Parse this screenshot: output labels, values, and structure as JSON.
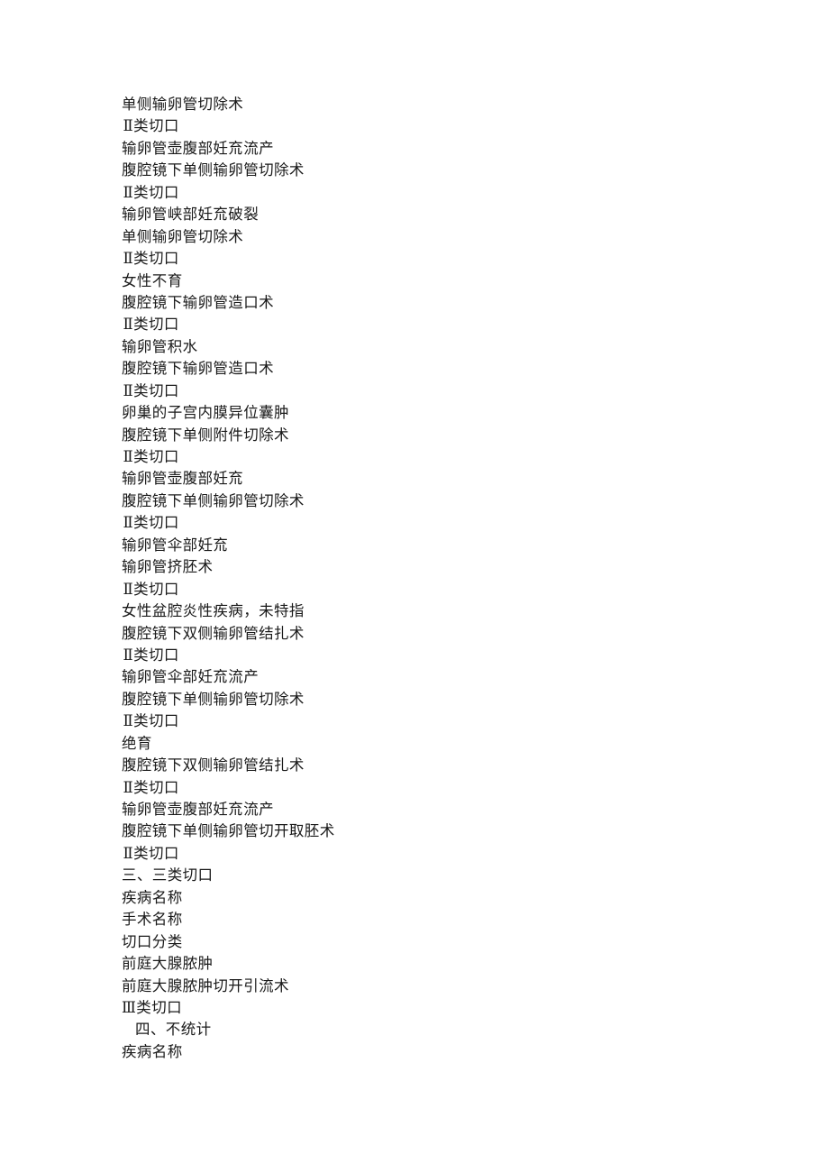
{
  "document": {
    "page_background": "#ffffff",
    "text_color": "#1a1a1a",
    "missing_glyph": "㐬",
    "lines": [
      {
        "text": "单侧输卵管切除术",
        "indent": "none"
      },
      {
        "text": "Ⅱ类切口",
        "indent": "roman"
      },
      {
        "text": "输卵管壶腹部妊㐬流产",
        "indent": "none"
      },
      {
        "text": "腹腔镜下单侧输卵管切除术",
        "indent": "none"
      },
      {
        "text": "Ⅱ类切口",
        "indent": "roman"
      },
      {
        "text": "输卵管峡部妊㐬破裂",
        "indent": "none"
      },
      {
        "text": "单侧输卵管切除术",
        "indent": "none"
      },
      {
        "text": "Ⅱ类切口",
        "indent": "roman"
      },
      {
        "text": "女性不育",
        "indent": "none"
      },
      {
        "text": "腹腔镜下输卵管造口术",
        "indent": "none"
      },
      {
        "text": "Ⅱ类切口",
        "indent": "roman"
      },
      {
        "text": "输卵管积水",
        "indent": "none"
      },
      {
        "text": "腹腔镜下输卵管造口术",
        "indent": "none"
      },
      {
        "text": "Ⅱ类切口",
        "indent": "roman"
      },
      {
        "text": "卵巢的子宫内膜异位囊肿",
        "indent": "none"
      },
      {
        "text": "腹腔镜下单侧附件切除术",
        "indent": "none"
      },
      {
        "text": "Ⅱ类切口",
        "indent": "roman"
      },
      {
        "text": "输卵管壶腹部妊㐬",
        "indent": "none"
      },
      {
        "text": "腹腔镜下单侧输卵管切除术",
        "indent": "none"
      },
      {
        "text": "Ⅱ类切口",
        "indent": "roman"
      },
      {
        "text": "输卵管伞部妊㐬",
        "indent": "none"
      },
      {
        "text": "输卵管挤胚术",
        "indent": "none"
      },
      {
        "text": "Ⅱ类切口",
        "indent": "roman"
      },
      {
        "text": "女性盆腔炎性疾病，未特指",
        "indent": "none"
      },
      {
        "text": "腹腔镜下双侧输卵管结扎术",
        "indent": "none"
      },
      {
        "text": "Ⅱ类切口",
        "indent": "roman"
      },
      {
        "text": "输卵管伞部妊㐬流产",
        "indent": "none"
      },
      {
        "text": "腹腔镜下单侧输卵管切除术",
        "indent": "none"
      },
      {
        "text": "Ⅱ类切口",
        "indent": "roman"
      },
      {
        "text": "绝育",
        "indent": "none"
      },
      {
        "text": "腹腔镜下双侧输卵管结扎术",
        "indent": "none"
      },
      {
        "text": "Ⅱ类切口",
        "indent": "roman"
      },
      {
        "text": "输卵管壶腹部妊㐬流产",
        "indent": "none"
      },
      {
        "text": "腹腔镜下单侧输卵管切开取胚术",
        "indent": "none"
      },
      {
        "text": "Ⅱ类切口",
        "indent": "roman"
      },
      {
        "text": "三、三类切口",
        "indent": "none"
      },
      {
        "text": "疾病名称",
        "indent": "none"
      },
      {
        "text": "手术名称",
        "indent": "none"
      },
      {
        "text": "切口分类",
        "indent": "none"
      },
      {
        "text": "前庭大腺脓肿",
        "indent": "none"
      },
      {
        "text": "前庭大腺脓肿切开引流术",
        "indent": "none"
      },
      {
        "text": "Ⅲ类切口",
        "indent": "none"
      },
      {
        "text": "四、不统计",
        "indent": "one"
      },
      {
        "text": "疾病名称",
        "indent": "none"
      }
    ]
  }
}
